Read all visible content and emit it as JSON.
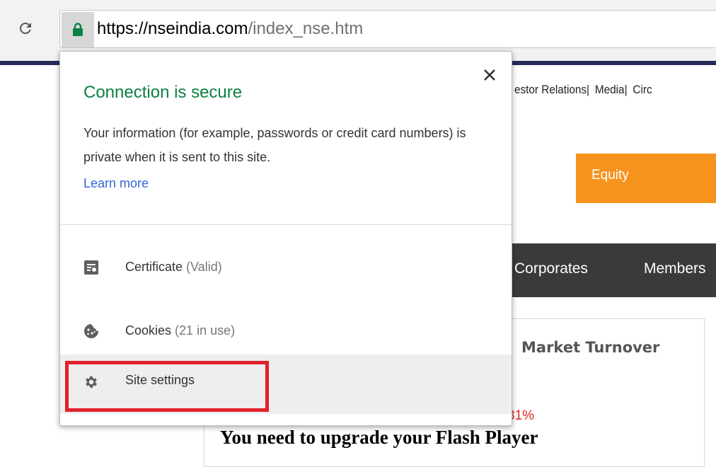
{
  "browser": {
    "url_host": "https://nseindia.com",
    "url_path": "/index_nse.htm"
  },
  "page": {
    "top_links": [
      "estor Relations|",
      "Media|",
      "Circ"
    ],
    "equity_tab": "Equity",
    "nav_items": [
      "Corporates",
      "Members"
    ],
    "panel_title": "Market Turnover",
    "percent_text": "31%",
    "flash_message": "You need to upgrade your Flash Player"
  },
  "popup": {
    "title": "Connection is secure",
    "description": "Your information (for example, passwords or credit card numbers) is private when it is sent to this site.",
    "learn_more": "Learn more",
    "certificate_label": "Certificate",
    "certificate_status": "(Valid)",
    "cookies_label": "Cookies",
    "cookies_status": "(21 in use)",
    "site_settings_label": "Site settings"
  },
  "colors": {
    "secure_green": "#0b8043",
    "link_blue": "#3367d6",
    "highlight_red": "#e1202a",
    "equity_orange": "#f6931e",
    "nav_dark": "#3a3a38",
    "percent_red": "#e0261e"
  },
  "icons": {
    "reload": "reload-icon",
    "lock": "lock-icon",
    "close": "close-icon",
    "certificate": "certificate-icon",
    "cookies": "cookie-icon",
    "site_settings": "gear-icon"
  }
}
